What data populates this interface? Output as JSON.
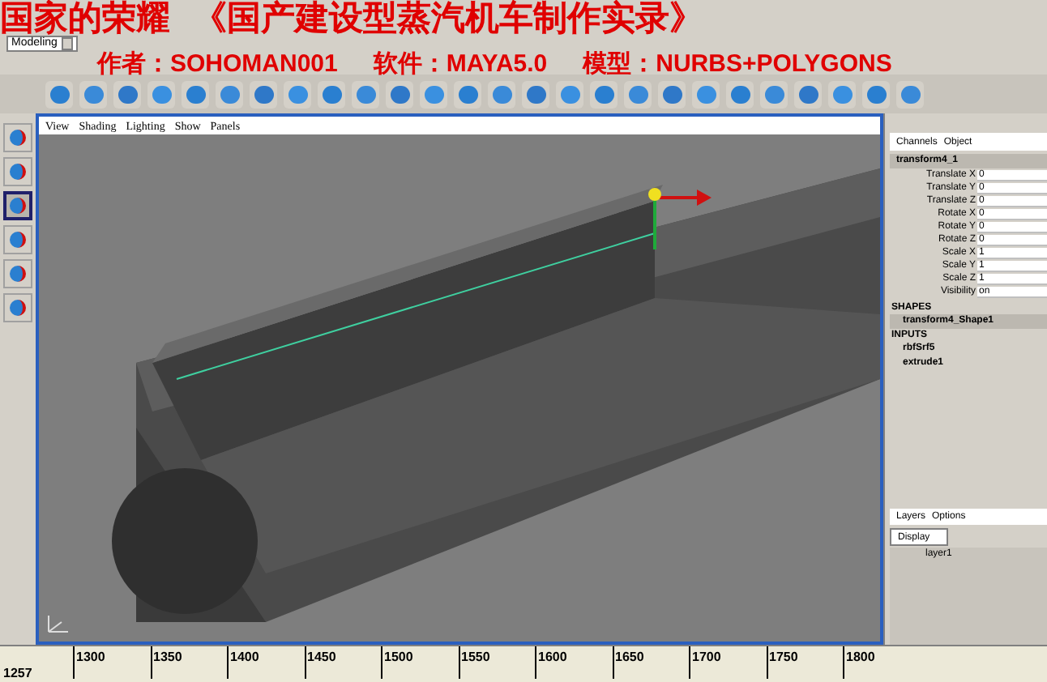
{
  "caption": {
    "line_1": [
      "国家的荣耀",
      "《国产建设型蒸汽机车制作实录》"
    ],
    "line_2": [
      "作者：SOHOMAN001",
      "软件：MAYA5.0",
      "模型：NURBS+POLYGONS"
    ]
  },
  "status_line": {
    "mode": "Modeling"
  },
  "toolbox": [
    {
      "selected": false
    },
    {
      "selected": false
    },
    {
      "selected": true
    },
    {
      "selected": false
    },
    {
      "selected": false
    },
    {
      "selected": false
    }
  ],
  "viewport": {
    "menu": [
      "View",
      "Shading",
      "Lighting",
      "Show",
      "Panels"
    ]
  },
  "channel_box": {
    "tabs": [
      "Channels",
      "Object"
    ],
    "node": "transform4_1",
    "attributes": [
      {
        "name": "Translate X",
        "value": "0"
      },
      {
        "name": "Translate Y",
        "value": "0"
      },
      {
        "name": "Translate Z",
        "value": "0"
      },
      {
        "name": "Rotate X",
        "value": "0"
      },
      {
        "name": "Rotate Y",
        "value": "0"
      },
      {
        "name": "Rotate Z",
        "value": "0"
      },
      {
        "name": "Scale X",
        "value": "1"
      },
      {
        "name": "Scale Y",
        "value": "1"
      },
      {
        "name": "Scale Z",
        "value": "1"
      },
      {
        "name": "Visibility",
        "value": "on"
      }
    ],
    "shapes_heading": "SHAPES",
    "shapes": [
      "transform4_Shape1"
    ],
    "inputs_heading": "INPUTS",
    "inputs": [
      "rbfSrf5",
      "extrude1"
    ]
  },
  "layers": {
    "tabs": [
      "Layers",
      "Options"
    ],
    "display": "Display",
    "items": [
      "layer1"
    ]
  },
  "timeline": {
    "current": "1257",
    "ticks": [
      "1300",
      "1350",
      "1400",
      "1450",
      "1500",
      "1550",
      "1600",
      "1650",
      "1700",
      "1750",
      "1800"
    ]
  }
}
